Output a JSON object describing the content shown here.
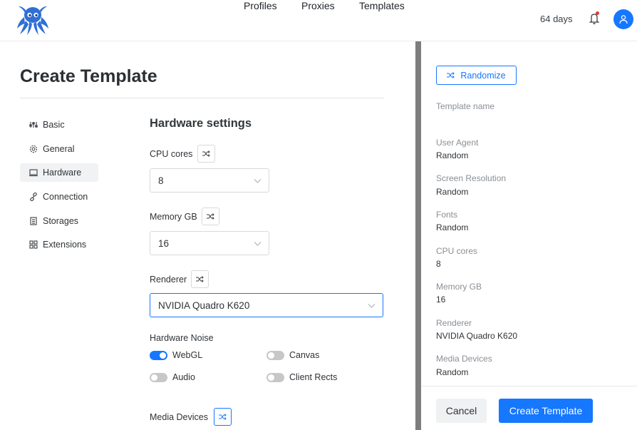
{
  "nav": {
    "items": [
      "Profiles",
      "Proxies",
      "Templates"
    ],
    "days_left": "64 days"
  },
  "icons": {
    "logo": "octopus-logo-icon",
    "bell": "bell-icon",
    "avatar": "user-icon",
    "shuffle": "shuffle-icon",
    "chevron": "chevron-down-icon"
  },
  "colors": {
    "accent": "#1677ff",
    "logo": "#2f6fd6",
    "notification_dot": "#e53935"
  },
  "page": {
    "title": "Create Template"
  },
  "sidebar": {
    "items": [
      {
        "label": "Basic",
        "icon": "sliders-icon",
        "active": false
      },
      {
        "label": "General",
        "icon": "gear-icon",
        "active": false
      },
      {
        "label": "Hardware",
        "icon": "laptop-icon",
        "active": true
      },
      {
        "label": "Connection",
        "icon": "link-icon",
        "active": false
      },
      {
        "label": "Storages",
        "icon": "storage-icon",
        "active": false
      },
      {
        "label": "Extensions",
        "icon": "grid-icon",
        "active": false
      }
    ]
  },
  "hardware": {
    "section_title": "Hardware settings",
    "cpu": {
      "label": "CPU cores",
      "value": "8"
    },
    "memory": {
      "label": "Memory GB",
      "value": "16"
    },
    "renderer": {
      "label": "Renderer",
      "value": "NVIDIA Quadro K620"
    },
    "noise": {
      "label": "Hardware Noise",
      "toggles": [
        {
          "label": "WebGL",
          "on": true
        },
        {
          "label": "Canvas",
          "on": false
        },
        {
          "label": "Audio",
          "on": false
        },
        {
          "label": "Client Rects",
          "on": false
        }
      ]
    },
    "media_devices_label": "Media Devices"
  },
  "summary": {
    "randomize_label": "Randomize",
    "template_name_label": "Template name",
    "rows": [
      {
        "label": "User Agent",
        "value": "Random"
      },
      {
        "label": "Screen Resolution",
        "value": "Random"
      },
      {
        "label": "Fonts",
        "value": "Random"
      },
      {
        "label": "CPU cores",
        "value": "8"
      },
      {
        "label": "Memory GB",
        "value": "16"
      },
      {
        "label": "Renderer",
        "value": "NVIDIA Quadro K620"
      },
      {
        "label": "Media Devices",
        "value": "Random"
      }
    ],
    "cancel_label": "Cancel",
    "create_label": "Create Template"
  }
}
